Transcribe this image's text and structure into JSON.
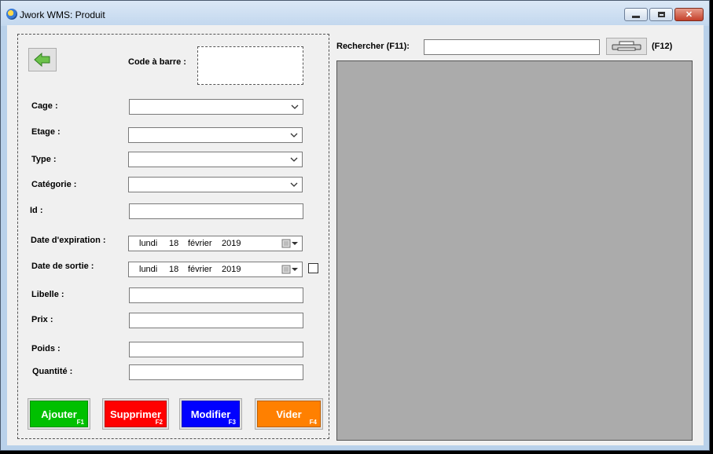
{
  "window": {
    "title": "Jwork WMS: Produit"
  },
  "form": {
    "barcode_label": "Code à barre :",
    "fields": {
      "cage": {
        "label": "Cage :",
        "value": ""
      },
      "etage": {
        "label": "Etage :",
        "value": ""
      },
      "type": {
        "label": "Type :",
        "value": ""
      },
      "categorie": {
        "label": "Catégorie :",
        "value": ""
      },
      "id": {
        "label": "Id :",
        "value": ""
      },
      "date_expiration": {
        "label": "Date d'expiration :",
        "weekday": "lundi",
        "day": "18",
        "month": "février",
        "year": "2019"
      },
      "date_sortie": {
        "label": "Date de sortie :",
        "weekday": "lundi",
        "day": "18",
        "month": "février",
        "year": "2019",
        "checked": false
      },
      "libelle": {
        "label": "Libelle :",
        "value": ""
      },
      "prix": {
        "label": "Prix :",
        "value": ""
      },
      "poids": {
        "label": "Poids :",
        "value": ""
      },
      "quantite": {
        "label": "Quantité :",
        "value": ""
      }
    },
    "buttons": {
      "ajouter": {
        "label": "Ajouter",
        "key": "F1",
        "color": "#00c000"
      },
      "supprimer": {
        "label": "Supprimer",
        "key": "F2",
        "color": "#ff0000"
      },
      "modifier": {
        "label": "Modifier",
        "key": "F3",
        "color": "#0000ff"
      },
      "vider": {
        "label": "Vider",
        "key": "F4",
        "color": "#ff8000"
      }
    }
  },
  "search": {
    "label": "Rechercher (F11):",
    "value": "",
    "print_shortcut": "(F12)"
  },
  "icons": {
    "back": "green-left-arrow-icon",
    "print": "printer-icon",
    "dropdown": "chevron-down-icon",
    "calendar": "calendar-icon"
  },
  "colors": {
    "window_frame": "#b9d1ea",
    "client_bg": "#f0f0f0",
    "grid_bg": "#ababab"
  }
}
